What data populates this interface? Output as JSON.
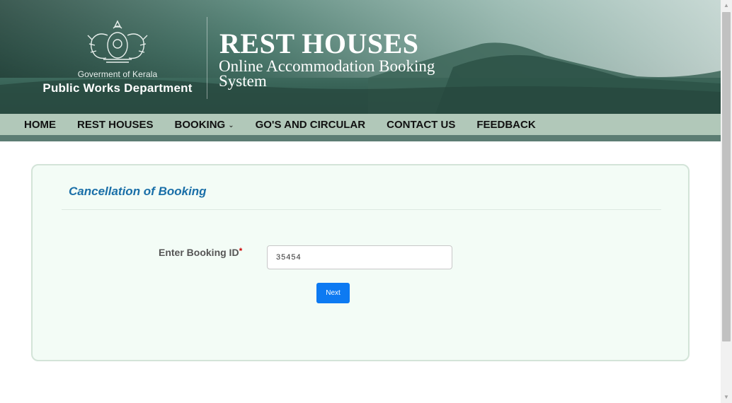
{
  "header": {
    "gov_label": "Goverment of Kerala",
    "dept_label": "Public Works Department",
    "site_title": "REST HOUSES",
    "site_subtitle": "Online Accommodation Booking System",
    "emblem_icon": "kerala-emblem-icon"
  },
  "nav": {
    "items": [
      {
        "label": "HOME"
      },
      {
        "label": "REST HOUSES"
      },
      {
        "label": "BOOKING",
        "has_dropdown": true,
        "caret": "⌄"
      },
      {
        "label": "GO'S AND CIRCULAR"
      },
      {
        "label": "CONTACT US"
      },
      {
        "label": "FEEDBACK"
      }
    ]
  },
  "form": {
    "title": "Cancellation of Booking",
    "field_label": "Enter Booking ID",
    "required_marker": "*",
    "booking_id_value": "35454",
    "next_label": "Next"
  },
  "colors": {
    "nav_bg": "#b2c8b9",
    "panel_bg": "#f3fcf6",
    "title_blue": "#1a6fa8",
    "button_blue": "#0d7af2"
  }
}
